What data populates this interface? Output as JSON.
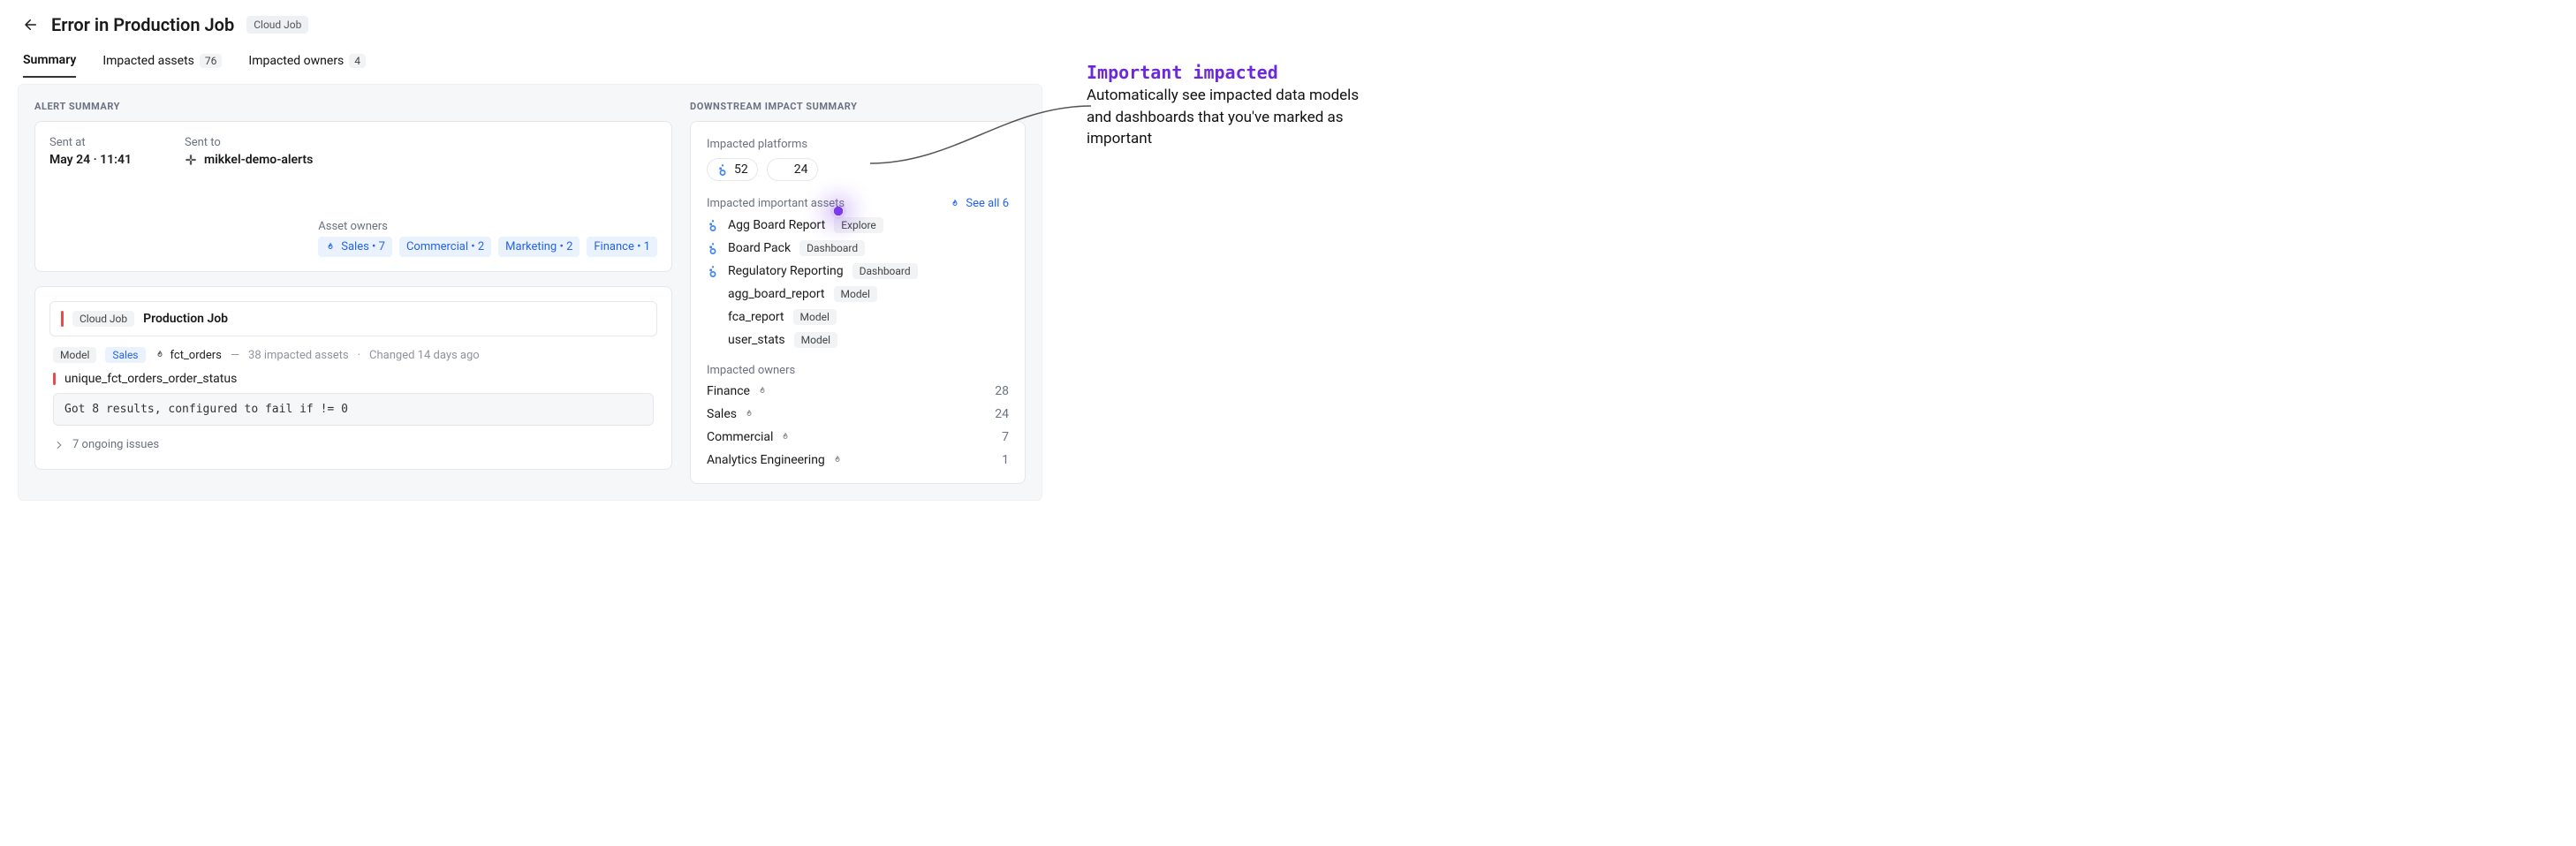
{
  "header": {
    "title": "Error in Production Job",
    "badge": "Cloud Job"
  },
  "tabs": {
    "summary": "Summary",
    "impacted_assets_label": "Impacted assets",
    "impacted_assets_count": "76",
    "impacted_owners_label": "Impacted owners",
    "impacted_owners_count": "4"
  },
  "alert_summary": {
    "section": "ALERT SUMMARY",
    "sent_at_label": "Sent at",
    "sent_at_value": "May 24 · 11:41",
    "sent_to_label": "Sent to",
    "sent_to_value": "mikkel-demo-alerts",
    "asset_owners_label": "Asset owners",
    "owners": [
      "Sales • 7",
      "Commercial • 2",
      "Marketing • 2",
      "Finance • 1"
    ]
  },
  "error": {
    "job_type": "Cloud Job",
    "job_name": "Production Job",
    "model_chip": "Model",
    "team_chip": "Sales",
    "asset_name": "fct_orders",
    "impacted_text": "38 impacted assets",
    "changed_text": "Changed 14 days ago",
    "test_name": "unique_fct_orders_order_status",
    "message": "Got 8 results, configured to fail if != 0",
    "ongoing": "7 ongoing issues"
  },
  "impact": {
    "section": "DOWNSTREAM IMPACT SUMMARY",
    "platforms_label": "Impacted platforms",
    "platforms": [
      {
        "icon": "looker",
        "count": "52"
      },
      {
        "icon": "dbt",
        "count": "24"
      }
    ],
    "important_label": "Impacted important assets",
    "see_all": "See all 6",
    "assets": [
      {
        "icon": "looker",
        "name": "Agg Board Report",
        "type": "Explore"
      },
      {
        "icon": "looker",
        "name": "Board Pack",
        "type": "Dashboard"
      },
      {
        "icon": "looker",
        "name": "Regulatory Reporting",
        "type": "Dashboard"
      },
      {
        "icon": "dbt",
        "name": "agg_board_report",
        "type": "Model"
      },
      {
        "icon": "dbt",
        "name": "fca_report",
        "type": "Model"
      },
      {
        "icon": "dbt",
        "name": "user_stats",
        "type": "Model"
      }
    ],
    "owners_label": "Impacted owners",
    "owners": [
      {
        "name": "Finance",
        "count": "28"
      },
      {
        "name": "Sales",
        "count": "24"
      },
      {
        "name": "Commercial",
        "count": "7"
      },
      {
        "name": "Analytics Engineering",
        "count": "1"
      }
    ]
  },
  "callout": {
    "title": "Important impacted",
    "body": "Automatically see impacted data models and dashboards that you've marked as important"
  },
  "icons": {
    "looker_color": "#4285F4",
    "dbt_color": "#FF694A"
  }
}
